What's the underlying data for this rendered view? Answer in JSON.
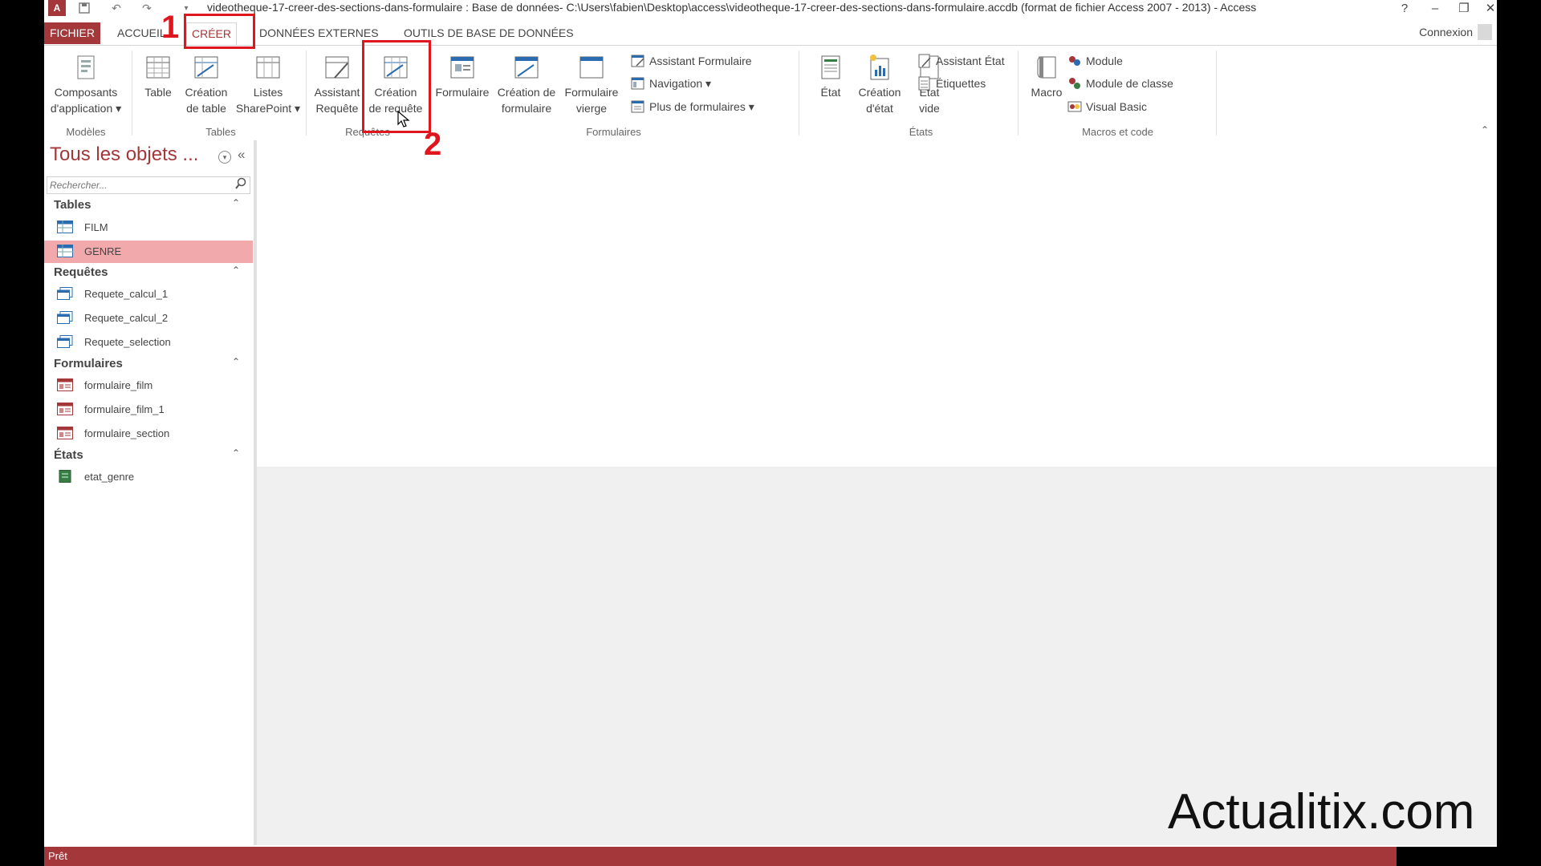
{
  "window": {
    "title": "videotheque-17-creer-des-sections-dans-formulaire : Base de données- C:\\Users\\fabien\\Desktop\\access\\videotheque-17-creer-des-sections-dans-formulaire.accdb (format de fichier Access 2007 - 2013) - Access",
    "help": "?",
    "minimize": "–",
    "restore": "❐",
    "close": "✕"
  },
  "tabs": {
    "file": "FICHIER",
    "home": "ACCUEIL",
    "create": "CRÉER",
    "external": "DONNÉES EXTERNES",
    "tools": "OUTILS DE BASE DE DONNÉES",
    "signin": "Connexion"
  },
  "ribbon": {
    "modeles": {
      "label": "Modèles",
      "app_parts": "Composants\nd'application"
    },
    "tables": {
      "label": "Tables",
      "table": "Table",
      "table_design": "Création\nde table",
      "sharepoint": "Listes\nSharePoint"
    },
    "requetes": {
      "label": "Requêtes",
      "query_wizard": "Assistant\nRequête",
      "query_design": "Création\nde requête"
    },
    "formulaires": {
      "label": "Formulaires",
      "form": "Formulaire",
      "form_design": "Création de\nformulaire",
      "blank_form": "Formulaire\nvierge",
      "form_wizard": "Assistant Formulaire",
      "navigation": "Navigation",
      "more_forms": "Plus de formulaires"
    },
    "etats": {
      "label": "États",
      "report": "État",
      "report_design": "Création\nd'état",
      "blank_report": "État\nvide",
      "report_wizard": "Assistant État",
      "labels": "Étiquettes"
    },
    "macros": {
      "label": "Macros et code",
      "macro": "Macro",
      "module": "Module",
      "class_module": "Module de classe",
      "visual_basic": "Visual Basic"
    }
  },
  "nav": {
    "title": "Tous les objets ...",
    "search_placeholder": "Rechercher...",
    "categories": [
      {
        "label": "Tables",
        "items": [
          "FILM",
          "GENRE"
        ]
      },
      {
        "label": "Requêtes",
        "items": [
          "Requete_calcul_1",
          "Requete_calcul_2",
          "Requete_selection"
        ]
      },
      {
        "label": "Formulaires",
        "items": [
          "formulaire_film",
          "formulaire_film_1",
          "formulaire_section"
        ]
      },
      {
        "label": "États",
        "items": [
          "etat_genre"
        ]
      }
    ],
    "selected_item": "GENRE"
  },
  "status": {
    "text": "Prêt"
  },
  "annotations": {
    "step1": "1",
    "step2": "2"
  },
  "watermark": "Actualitix.com",
  "colors": {
    "accent": "#a4373a",
    "selected": "#f1a9ab",
    "annotation": "#e0161f"
  }
}
